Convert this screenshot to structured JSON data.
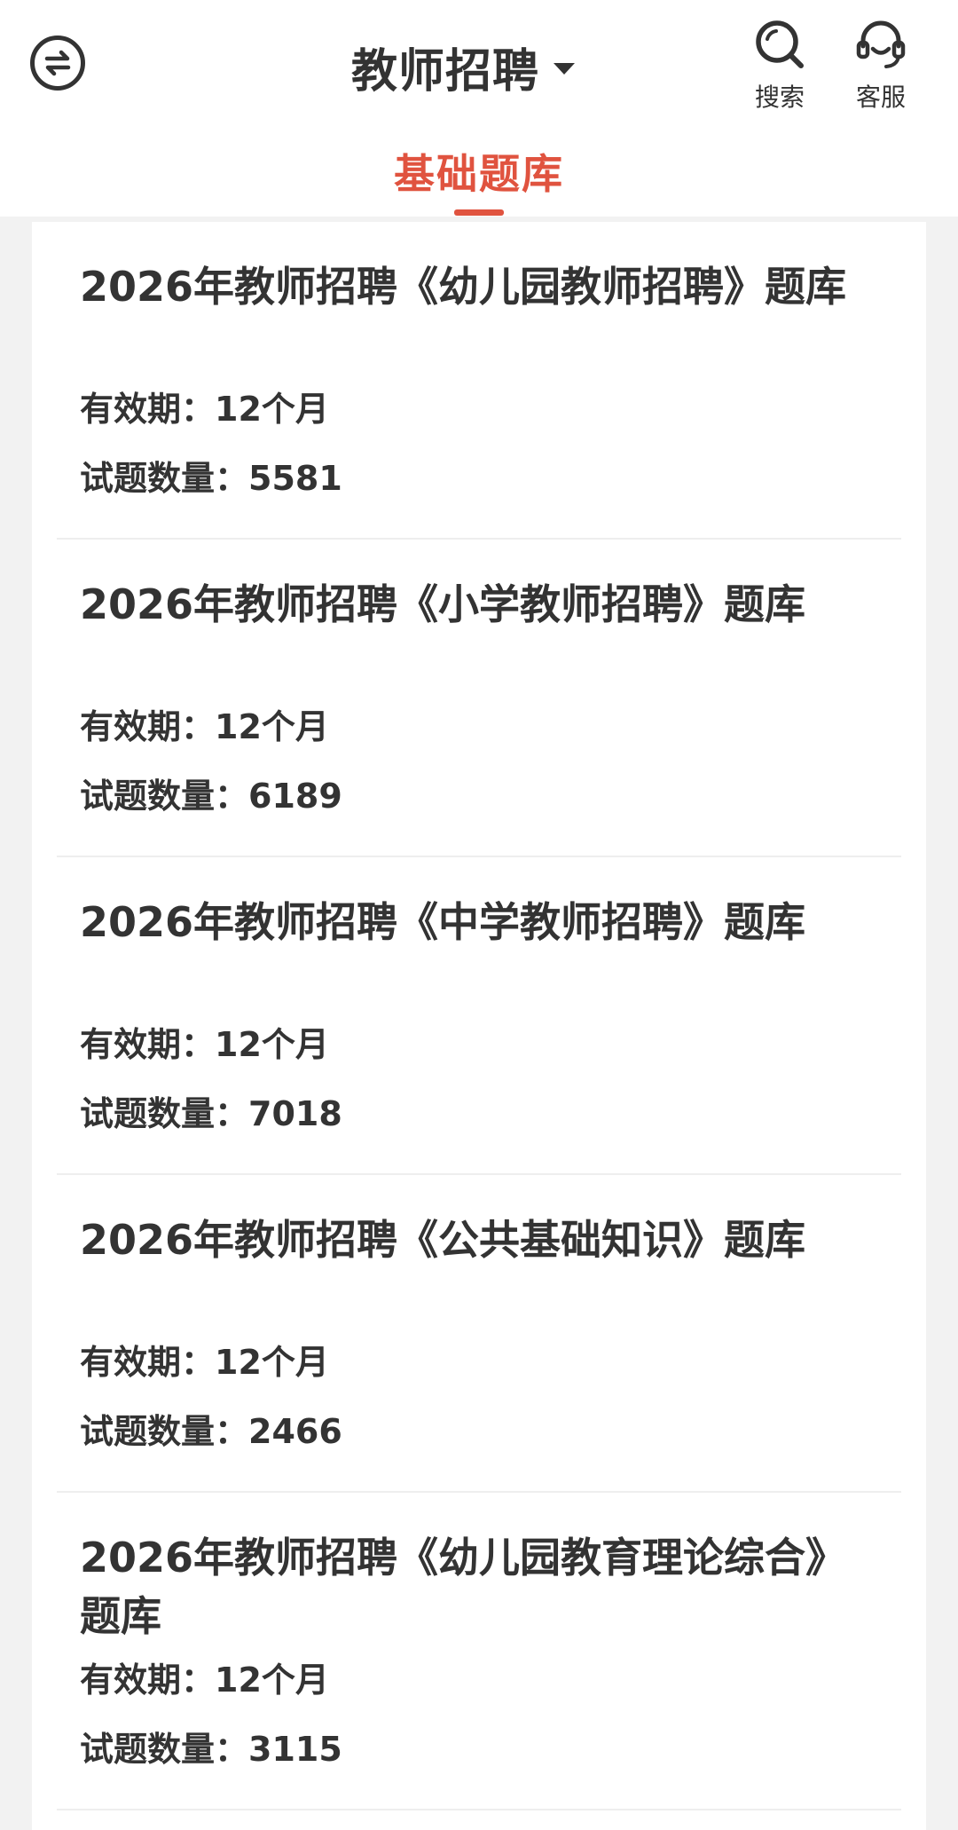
{
  "header": {
    "title": "教师招聘",
    "search_label": "搜索",
    "service_label": "客服"
  },
  "tab": {
    "label": "基础题库"
  },
  "items": [
    {
      "title": "2026年教师招聘《幼儿园教师招聘》题库",
      "validity_label": "有效期：",
      "validity": "12个月",
      "count_label": "试题数量：",
      "count": "5581"
    },
    {
      "title": "2026年教师招聘《小学教师招聘》题库",
      "validity_label": "有效期：",
      "validity": "12个月",
      "count_label": "试题数量：",
      "count": "6189"
    },
    {
      "title": "2026年教师招聘《中学教师招聘》题库",
      "validity_label": "有效期：",
      "validity": "12个月",
      "count_label": "试题数量：",
      "count": "7018"
    },
    {
      "title": "2026年教师招聘《公共基础知识》题库",
      "validity_label": "有效期：",
      "validity": "12个月",
      "count_label": "试题数量：",
      "count": "2466"
    },
    {
      "title": "2026年教师招聘《幼儿园教育理论综合》题库",
      "validity_label": "有效期：",
      "validity": "12个月",
      "count_label": "试题数量：",
      "count": "3115"
    }
  ],
  "colors": {
    "accent": "#e0533f",
    "text": "#333333",
    "background": "#f2f2f2"
  },
  "icons": [
    "switch-icon",
    "search-icon",
    "headset-icon",
    "caret-down-icon"
  ]
}
